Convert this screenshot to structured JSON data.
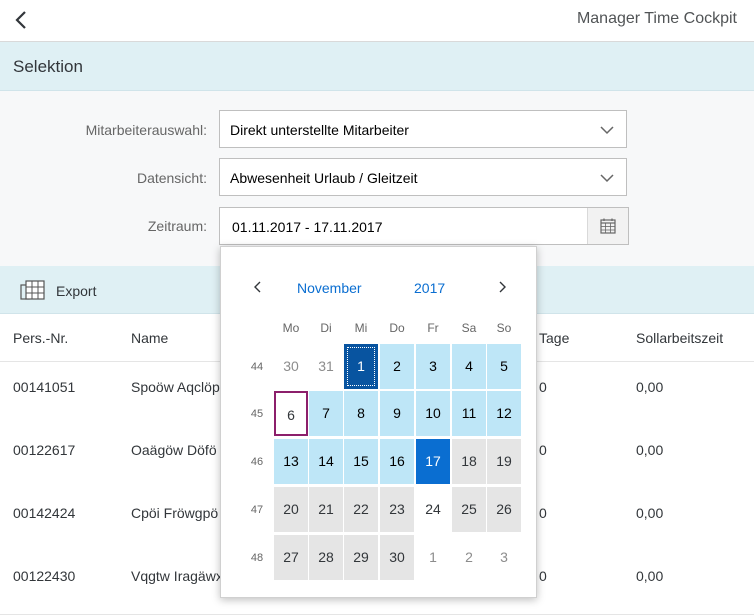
{
  "header": {
    "title": "Manager Time Cockpit"
  },
  "selection": {
    "title": "Selektion",
    "employee_label": "Mitarbeiterauswahl:",
    "employee_value": "Direkt unterstellte Mitarbeiter",
    "view_label": "Datensicht:",
    "view_value": "Abwesenheit Urlaub / Gleitzeit",
    "period_label": "Zeitraum:",
    "period_value": "01.11.2017 - 17.11.2017"
  },
  "toolbar": {
    "export_label": "Export"
  },
  "table": {
    "columns": [
      "Pers.-Nr.",
      "Name",
      "Tage",
      "Sollarbeitszeit"
    ],
    "rows": [
      {
        "pers": "00141051",
        "name": "Spoöw Aqclöp",
        "tage": "0",
        "soll": "0,00"
      },
      {
        "pers": "00122617",
        "name": "Oaägöw Döfö",
        "tage": "0",
        "soll": "0,00"
      },
      {
        "pers": "00142424",
        "name": "Cpöi Fröwgpö",
        "tage": "0",
        "soll": "0,00"
      },
      {
        "pers": "00122430",
        "name": "Vqgtw Iragäwx",
        "tage": "0",
        "soll": "0,00"
      }
    ]
  },
  "calendar": {
    "month": "November",
    "year": "2017",
    "weekdays": [
      "Mo",
      "Di",
      "Mi",
      "Do",
      "Fr",
      "Sa",
      "So"
    ],
    "weeks": [
      {
        "num": "44",
        "days": [
          {
            "d": "30",
            "s": "other"
          },
          {
            "d": "31",
            "s": "other"
          },
          {
            "d": "1",
            "s": "start"
          },
          {
            "d": "2",
            "s": "cur"
          },
          {
            "d": "3",
            "s": "cur"
          },
          {
            "d": "4",
            "s": "cur"
          },
          {
            "d": "5",
            "s": "cur"
          }
        ]
      },
      {
        "num": "45",
        "days": [
          {
            "d": "6",
            "s": "today"
          },
          {
            "d": "7",
            "s": "cur"
          },
          {
            "d": "8",
            "s": "cur"
          },
          {
            "d": "9",
            "s": "cur"
          },
          {
            "d": "10",
            "s": "cur"
          },
          {
            "d": "11",
            "s": "cur"
          },
          {
            "d": "12",
            "s": "cur"
          }
        ]
      },
      {
        "num": "46",
        "days": [
          {
            "d": "13",
            "s": "cur"
          },
          {
            "d": "14",
            "s": "cur"
          },
          {
            "d": "15",
            "s": "cur"
          },
          {
            "d": "16",
            "s": "cur"
          },
          {
            "d": "17",
            "s": "sel"
          },
          {
            "d": "18",
            "s": "next"
          },
          {
            "d": "19",
            "s": "next"
          }
        ]
      },
      {
        "num": "47",
        "days": [
          {
            "d": "20",
            "s": "next"
          },
          {
            "d": "21",
            "s": "next"
          },
          {
            "d": "22",
            "s": "next"
          },
          {
            "d": "23",
            "s": "next"
          },
          {
            "d": "24",
            "s": "plain"
          },
          {
            "d": "25",
            "s": "next"
          },
          {
            "d": "26",
            "s": "next"
          }
        ]
      },
      {
        "num": "48",
        "days": [
          {
            "d": "27",
            "s": "next"
          },
          {
            "d": "28",
            "s": "next"
          },
          {
            "d": "29",
            "s": "next"
          },
          {
            "d": "30",
            "s": "next"
          },
          {
            "d": "1",
            "s": "other"
          },
          {
            "d": "2",
            "s": "other"
          },
          {
            "d": "3",
            "s": "other"
          }
        ]
      }
    ]
  },
  "icons": {
    "back": "chevron-left-icon",
    "dropdown": "chevron-down-icon",
    "calendar": "calendar-icon",
    "export": "export-icon",
    "prev": "chevron-left-icon",
    "next": "chevron-right-icon"
  },
  "colors": {
    "header_band": "#dff0f4",
    "range_day": "#bee6f7",
    "selected_day": "#0a6ed1",
    "range_start": "#0854a0",
    "today_border": "#8c1f6b",
    "link": "#0a6ed1"
  }
}
